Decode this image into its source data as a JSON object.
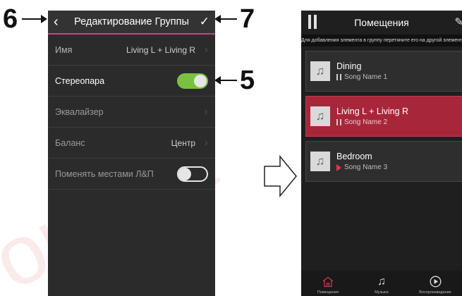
{
  "callouts": {
    "left_top": "6",
    "right_top": "7",
    "right_mid": "5"
  },
  "edit_group": {
    "title": "Редактирование Группы",
    "rows": [
      {
        "label": "Имя",
        "value": "Living L + Living R"
      },
      {
        "label": "Стереопара",
        "toggle": "on"
      },
      {
        "label": "Эквалайзер"
      },
      {
        "label": "Баланс",
        "value": "Центр"
      },
      {
        "label": "Поменять местами Л&П",
        "toggle": "off"
      }
    ]
  },
  "rooms_screen": {
    "title": "Помещения",
    "hint": "Для добавления элемента в группу перетяните его на другой элемент",
    "rooms": [
      {
        "name": "Dining",
        "song": "Song Name 1",
        "state": "paused"
      },
      {
        "name": "Living L + Living R",
        "song": "Song Name 2",
        "state": "paused",
        "active": true
      },
      {
        "name": "Bedroom",
        "song": "Song Name 3",
        "state": "playing"
      }
    ],
    "nav": [
      {
        "label": "Помещения",
        "icon": "house-icon",
        "active": true
      },
      {
        "label": "Музыка",
        "icon": "music-note-icon"
      },
      {
        "label": "Воспроизведение",
        "icon": "play-circle-icon"
      }
    ]
  },
  "colors": {
    "accent_pink": "#d6417a",
    "active_room": "#a8263a",
    "toggle_on": "#7bc043"
  }
}
